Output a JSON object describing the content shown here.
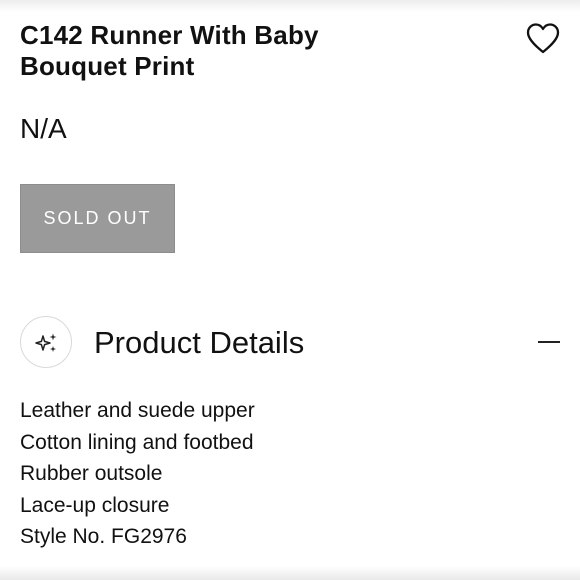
{
  "product": {
    "title_lines": [
      "C142 Runner With Baby",
      "Bouquet Print"
    ],
    "price": "N/A",
    "sold_out_label": "SOLD OUT"
  },
  "icons": {
    "wishlist": "heart-icon",
    "details": "sparkle-icon",
    "collapse": "minus-icon"
  },
  "details": {
    "heading": "Product Details",
    "items": [
      "Leather and suede upper",
      "Cotton lining and footbed",
      "Rubber outsole",
      "Lace-up closure",
      "Style No. FG2976"
    ]
  },
  "colors": {
    "sold_out_bg": "#9a9a9a",
    "text": "#111111"
  }
}
